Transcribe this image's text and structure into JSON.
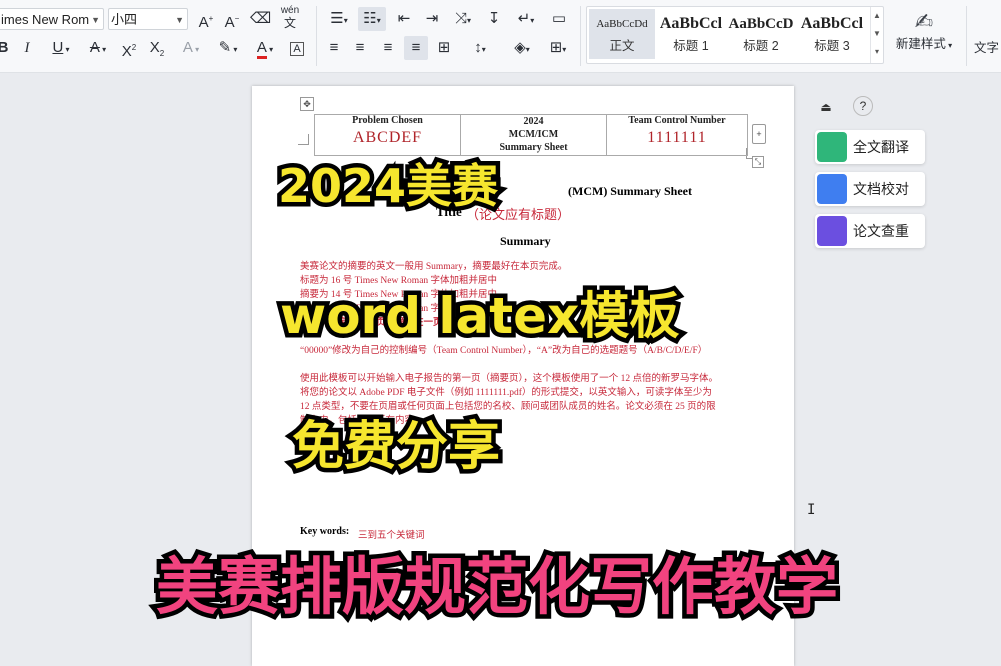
{
  "ribbon": {
    "font_name": "imes New Rom",
    "font_size": "小四",
    "phonetic_label": "wén",
    "styles": [
      {
        "sample": "AaBbCcDd",
        "name": "正文"
      },
      {
        "sample": "AaBbCcl",
        "name": "标题 1"
      },
      {
        "sample": "AaBbCcD",
        "name": "标题 2"
      },
      {
        "sample": "AaBbCcl",
        "name": "标题 3"
      }
    ],
    "new_style": "新建样式",
    "text_tools": "文字"
  },
  "document": {
    "problem_chosen_label": "Problem Chosen",
    "problem_chosen_value": "ABCDEF",
    "year": "2024",
    "contest": "MCM/ICM",
    "summary_sheet_label": "Summary Sheet",
    "team_control_label": "Team Control Number",
    "team_control_value": "1111111",
    "sheet_title_left": "Mat",
    "sheet_title_right": "(MCM) Summary Sheet",
    "title_label": "Title",
    "title_hint": "（论文应有标题）",
    "summary_heading": "Summary",
    "lines": [
      "美赛论文的摘要的英文一般用 Summary，摘要最好在本页完成。",
      "标题为 16 号 Times New Roman 字体加粗并居中",
      "摘要为 14 号 Times New Roman 字体加粗并居中",
      "正文为 12 号 Times New Roman 字体",
      "第一页一定是摘要页，摘要在一页",
      "“00000”修改为自己的控制编号（Team Control Number），“A”改为自己的选题题号（A/B/C/D/E/F）",
      "使用此模板可以开始输入电子报告的第一页（摘要页），这个模板使用了一个 12 点倍的新罗马字体。",
      "将您的论文以 Adobe PDF 电子文件（例如 1111111.pdf）的形式提交，以英文输入，可读字体至少为",
      "12 点类型，不要在页眉或任何页面上包括您的名校、顾问或团队成员的姓名。论文必须在 25 页的限",
      "制之内，包括上述所有内容。"
    ],
    "keywords_label": "Key words:",
    "keywords_value": "三到五个关键词"
  },
  "overlay": {
    "line1": "2024美赛",
    "line2": "word latex模板",
    "line3": "免费分享",
    "line4": "美赛排版规范化写作教学"
  },
  "side_panel": {
    "items": [
      {
        "label": "全文翻译",
        "color": "#2fb67a"
      },
      {
        "label": "文档校对",
        "color": "#3f7ef0"
      },
      {
        "label": "论文查重",
        "color": "#6b4fe0"
      }
    ],
    "help": "?"
  }
}
